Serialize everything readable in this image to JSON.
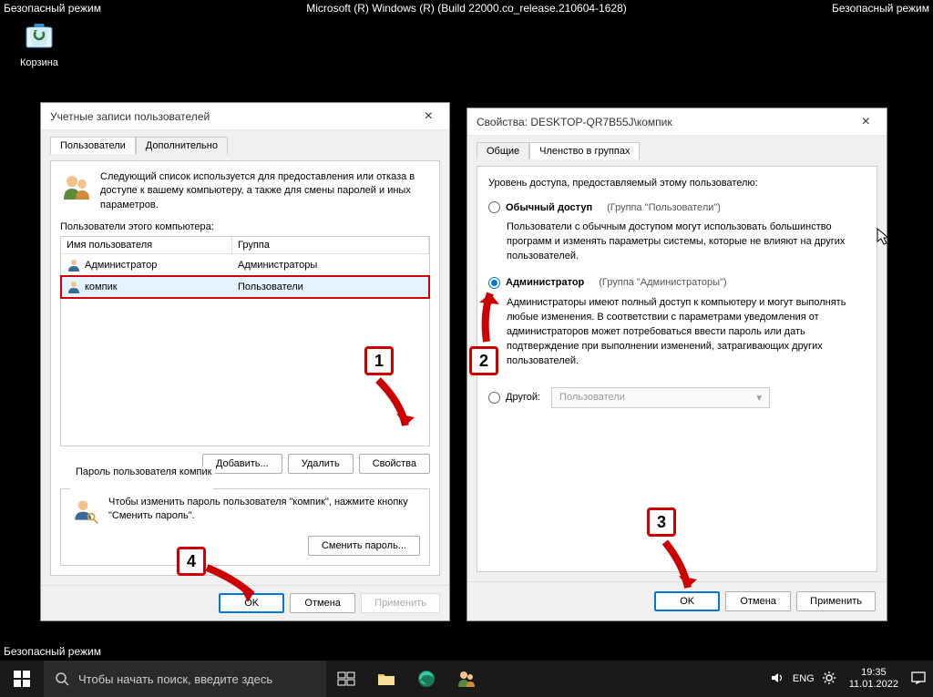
{
  "safe_mode": {
    "text": "Безопасный режим",
    "build": "Microsoft (R) Windows (R) (Build 22000.co_release.210604-1628)"
  },
  "desktop": {
    "recycle": "Корзина"
  },
  "left_win": {
    "title": "Учетные записи пользователей",
    "tabs": {
      "users": "Пользователи",
      "advanced": "Дополнительно"
    },
    "info": "Следующий список используется для предоставления или отказа в доступе к вашему компьютеру, а также для смены паролей и иных параметров.",
    "list_label": "Пользователи этого компьютера:",
    "columns": {
      "name": "Имя пользователя",
      "group": "Группа"
    },
    "rows": [
      {
        "name": "Администратор",
        "group": "Администраторы"
      },
      {
        "name": "компик",
        "group": "Пользователи"
      }
    ],
    "buttons": {
      "add": "Добавить...",
      "remove": "Удалить",
      "props": "Свойства"
    },
    "password_group": {
      "legend": "Пароль пользователя компик",
      "text": "Чтобы изменить пароль пользователя \"компик\", нажмите кнопку \"Сменить пароль\".",
      "btn": "Сменить пароль..."
    },
    "footer": {
      "ok": "OK",
      "cancel": "Отмена",
      "apply": "Применить"
    }
  },
  "right_win": {
    "title": "Свойства: DESKTOP-QR7B55J\\компик",
    "tabs": {
      "general": "Общие",
      "membership": "Членство в группах"
    },
    "heading": "Уровень доступа, предоставляемый этому пользователю:",
    "opt_user": {
      "label": "Обычный доступ",
      "group": "(Группа \"Пользователи\")",
      "desc": "Пользователи с обычным доступом могут использовать большинство программ и изменять параметры системы, которые не влияют на других пользователей."
    },
    "opt_admin": {
      "label": "Администратор",
      "group": "(Группа \"Администраторы\")",
      "desc": "Администраторы имеют полный доступ к компьютеру и могут выполнять любые изменения. В соответствии с параметрами уведомления от администраторов может потребоваться ввести пароль или дать подтверждение при выполнении изменений, затрагивающих других пользователей."
    },
    "opt_other": {
      "label": "Другой:",
      "combo": "Пользователи"
    },
    "footer": {
      "ok": "OK",
      "cancel": "Отмена",
      "apply": "Применить"
    }
  },
  "annotations": {
    "a1": "1",
    "a2": "2",
    "a3": "3",
    "a4": "4"
  },
  "taskbar": {
    "search_placeholder": "Чтобы начать поиск, введите здесь",
    "lang": "ENG",
    "time": "19:35",
    "date": "11.01.2022"
  }
}
